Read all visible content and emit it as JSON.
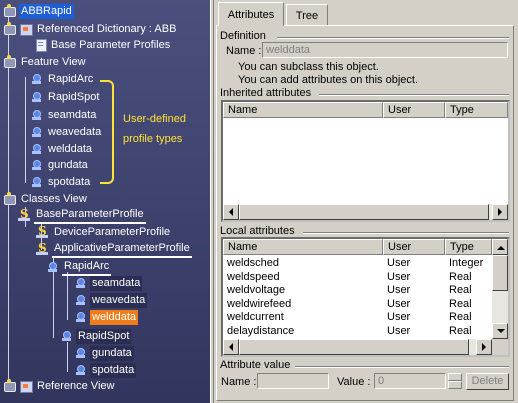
{
  "tree": {
    "root": "ABBRapid",
    "referenced_dictionary": "Referenced Dictionary : ABB",
    "base_parameter_profiles": "Base Parameter Profiles",
    "feature_view": "Feature View",
    "feature_items": [
      "RapidArc",
      "RapidSpot",
      "seamdata",
      "weavedata",
      "welddata",
      "gundata",
      "spotdata"
    ],
    "annotation_line1": "User-defined",
    "annotation_line2": "profile types",
    "classes_view": "Classes View",
    "base_parameter_profile": "BaseParameterProfile",
    "device_parameter_profile": "DeviceParameterProfile",
    "applicative_parameter_profile": "ApplicativeParameterProfile",
    "rapid_arc": "RapidArc",
    "rapid_arc_children": [
      "seamdata",
      "weavedata",
      "welddata"
    ],
    "rapid_spot": "RapidSpot",
    "rapid_spot_children": [
      "gundata",
      "spotdata"
    ],
    "reference_view": "Reference View",
    "highlight_color": "#f07d1c",
    "annotation_color": "#ffe234"
  },
  "tabs": {
    "attributes": "Attributes",
    "tree": "Tree"
  },
  "definition": {
    "title": "Definition",
    "name_label": "Name :",
    "name_value": "welddata",
    "line1": "You can subclass this object.",
    "line2": "You can add attributes on this object."
  },
  "inherited": {
    "title": "Inherited attributes",
    "columns": [
      "Name",
      "User",
      "Type"
    ]
  },
  "local": {
    "title": "Local attributes",
    "columns": [
      "Name",
      "User",
      "Type"
    ],
    "rows": [
      [
        "weldsched",
        "User",
        "Integer"
      ],
      [
        "weldspeed",
        "User",
        "Real"
      ],
      [
        "weldvoltage",
        "User",
        "Real"
      ],
      [
        "weldwirefeed",
        "User",
        "Real"
      ],
      [
        "weldcurrent",
        "User",
        "Real"
      ],
      [
        "delaydistance",
        "User",
        "Real"
      ]
    ]
  },
  "attribute_value": {
    "title": "Attribute value",
    "name_label": "Name :",
    "name_value": "",
    "value_label": "Value :",
    "value_value": "0",
    "delete_label": "Delete"
  }
}
